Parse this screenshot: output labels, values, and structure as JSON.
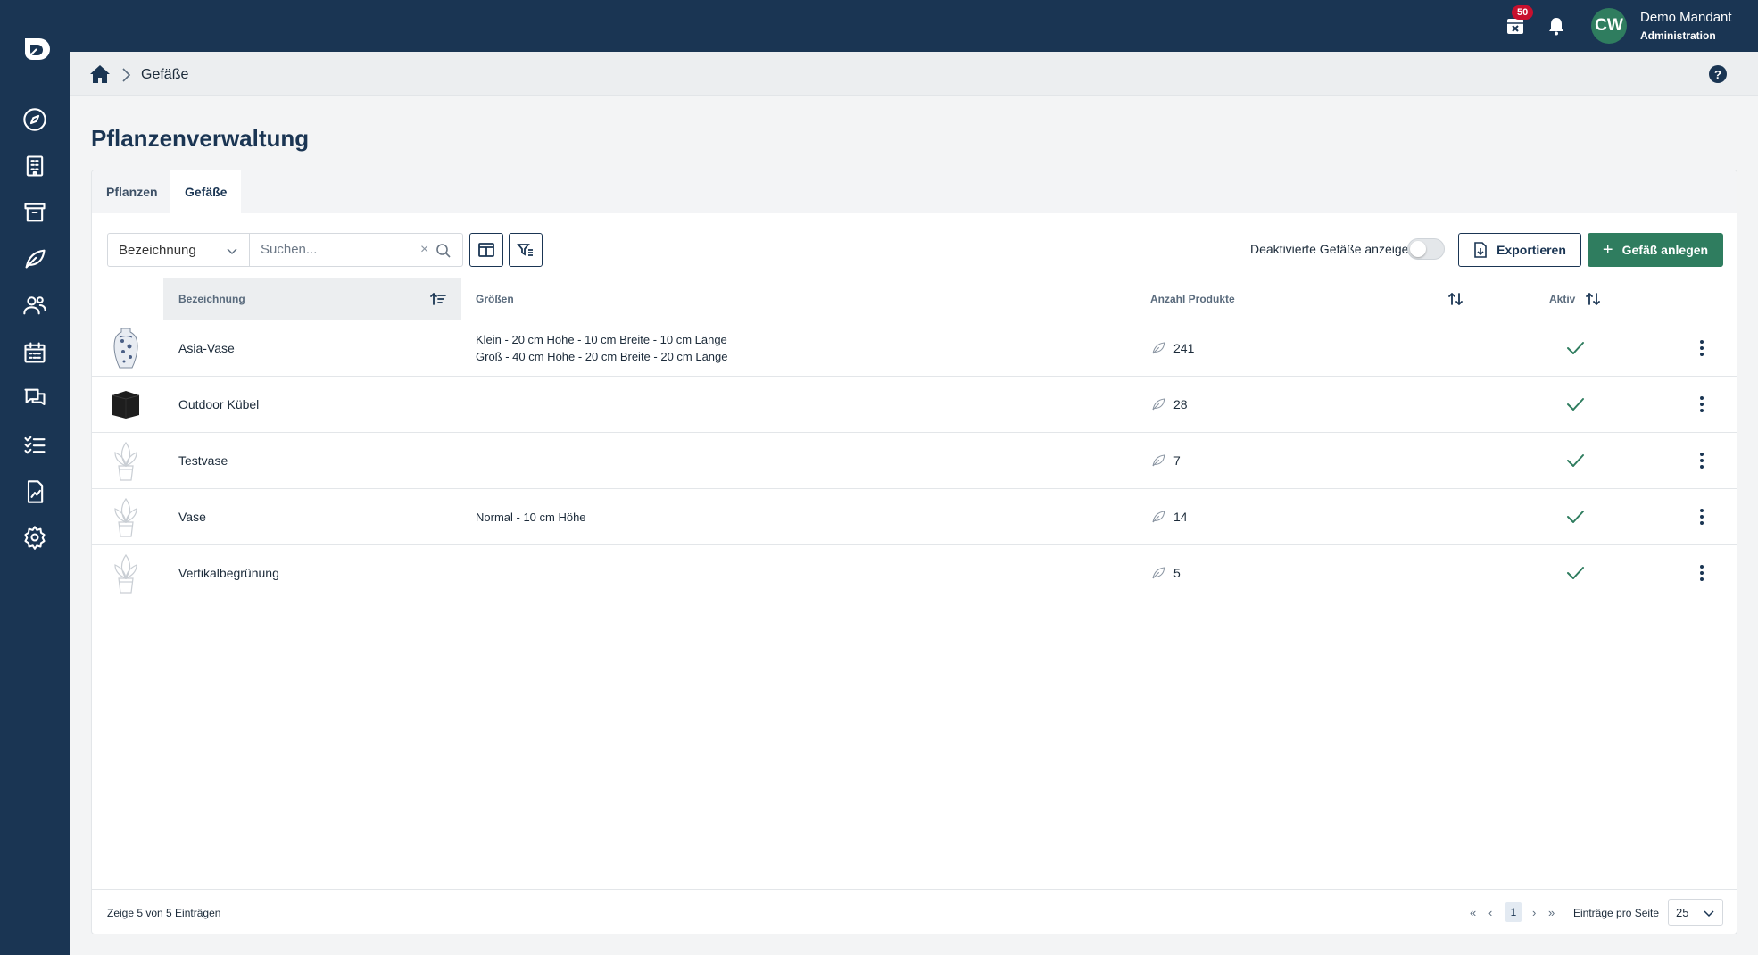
{
  "topbar": {
    "notification_count": "50",
    "user": {
      "initials": "CW",
      "name": "Demo Mandant",
      "role": "Administration"
    }
  },
  "breadcrumb": {
    "current": "Gefäße"
  },
  "page": {
    "title": "Pflanzenverwaltung"
  },
  "tabs": [
    {
      "label": "Pflanzen"
    },
    {
      "label": "Gefäße"
    }
  ],
  "toolbar": {
    "filter_field": "Bezeichnung",
    "search_placeholder": "Suchen...",
    "toggle_label": "Deaktivierte Gefäße anzeigen",
    "export_label": "Exportieren",
    "add_label": "Gefäß anlegen"
  },
  "table": {
    "columns": {
      "name": "Bezeichnung",
      "sizes": "Größen",
      "count": "Anzahl Produkte",
      "active": "Aktiv"
    },
    "rows": [
      {
        "name": "Asia-Vase",
        "size1": "Klein - 20 cm Höhe - 10 cm Breite - 10 cm Länge",
        "size2": "Groß - 40 cm Höhe - 20 cm Breite - 20 cm Länge",
        "count": "241",
        "active": true,
        "thumb": "asia-vase-image"
      },
      {
        "name": "Outdoor Kübel",
        "size1": "",
        "size2": "",
        "count": "28",
        "active": true,
        "thumb": "black-cube-image"
      },
      {
        "name": "Testvase",
        "size1": "",
        "size2": "",
        "count": "7",
        "active": true,
        "thumb": "plant-placeholder-icon"
      },
      {
        "name": "Vase",
        "size1": "Normal - 10 cm Höhe",
        "size2": "",
        "count": "14",
        "active": true,
        "thumb": "plant-placeholder-icon"
      },
      {
        "name": "Vertikalbegrünung",
        "size1": "",
        "size2": "",
        "count": "5",
        "active": true,
        "thumb": "plant-placeholder-icon"
      }
    ]
  },
  "footer": {
    "info": "Zeige 5 von 5 Einträgen",
    "current_page": "1",
    "per_page_label": "Einträge pro Seite",
    "per_page": "25"
  },
  "colors": {
    "navy": "#1a3553",
    "green": "#2f7d5f",
    "badge": "#c8102e"
  }
}
